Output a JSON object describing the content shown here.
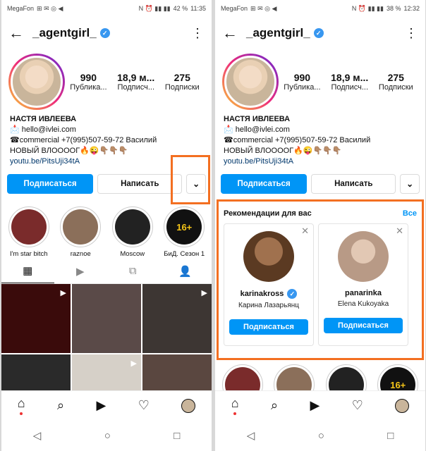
{
  "status": {
    "left": {
      "carrier": "MegaFon",
      "flags": "⊞ ✉ ◎ ◀"
    },
    "right": {
      "icons": "N ⏰ ▮▮ ▮▮",
      "battery": "42 %",
      "time": "11:35"
    }
  },
  "status_right_screen": {
    "left": {
      "carrier": "MegaFon",
      "flags": "⊞ ✉ ◎ ◀"
    },
    "right": {
      "icons": "N ⏰ ▮▮ ▮▮",
      "battery": "38 %",
      "time": "12:32"
    }
  },
  "profile": {
    "username": "_agentgirl_",
    "stats": [
      {
        "value": "990",
        "label": "Публика..."
      },
      {
        "value": "18,9 м...",
        "label": "Подписч..."
      },
      {
        "value": "275",
        "label": "Подписки"
      }
    ],
    "bio": {
      "name": "НАСТЯ ИВЛЕЕВА",
      "email": "📩 hello@ivlei.com",
      "phone": "☎commercial +7(995)507-59-72 Василий",
      "tagline": "НОВЫЙ ВЛОООOГ🔥😜👇🏽👇🏽👇🏽",
      "link": "youtu.be/PitsUji34tA"
    },
    "buttons": {
      "follow": "Подписаться",
      "message": "Написать",
      "chevron": "⌄"
    }
  },
  "highlights": [
    {
      "label": "I'm star bitch",
      "color": "#7a2b2b"
    },
    {
      "label": "raznoe",
      "color": "#8b6f5a"
    },
    {
      "label": "Moscow",
      "color": "#222222"
    },
    {
      "label": "БиД. Сезон 1",
      "color": "#111111",
      "badge": "16+"
    }
  ],
  "tabs": {
    "grid": "▦",
    "reels": "▶",
    "igtv": "⧉",
    "tagged": "👤"
  },
  "grid_colors": [
    "#3a0b0b",
    "#5a4a48",
    "#3d3633",
    "#2a2a2a",
    "#d6d0c8",
    "#5a4740"
  ],
  "recommendations": {
    "title": "Рекомендации для вас",
    "see_all": "Все",
    "cards": [
      {
        "username": "karinakross",
        "name": "Карина Лазарьянц",
        "button": "Подписаться",
        "color": "#5b3a22",
        "verified": true
      },
      {
        "username": "panarinka",
        "name": "Elena Kukoyaka",
        "button": "Подписаться",
        "color": "#b89a86",
        "verified": false
      }
    ]
  },
  "bottom_nav": {
    "home": "⌂",
    "search": "⌕",
    "reels": "▶",
    "likes": "♡"
  },
  "system_nav": {
    "back": "◁",
    "home": "○",
    "recents": "□"
  },
  "highlight_color": "#f36f21",
  "accent_color": "#0095f6"
}
